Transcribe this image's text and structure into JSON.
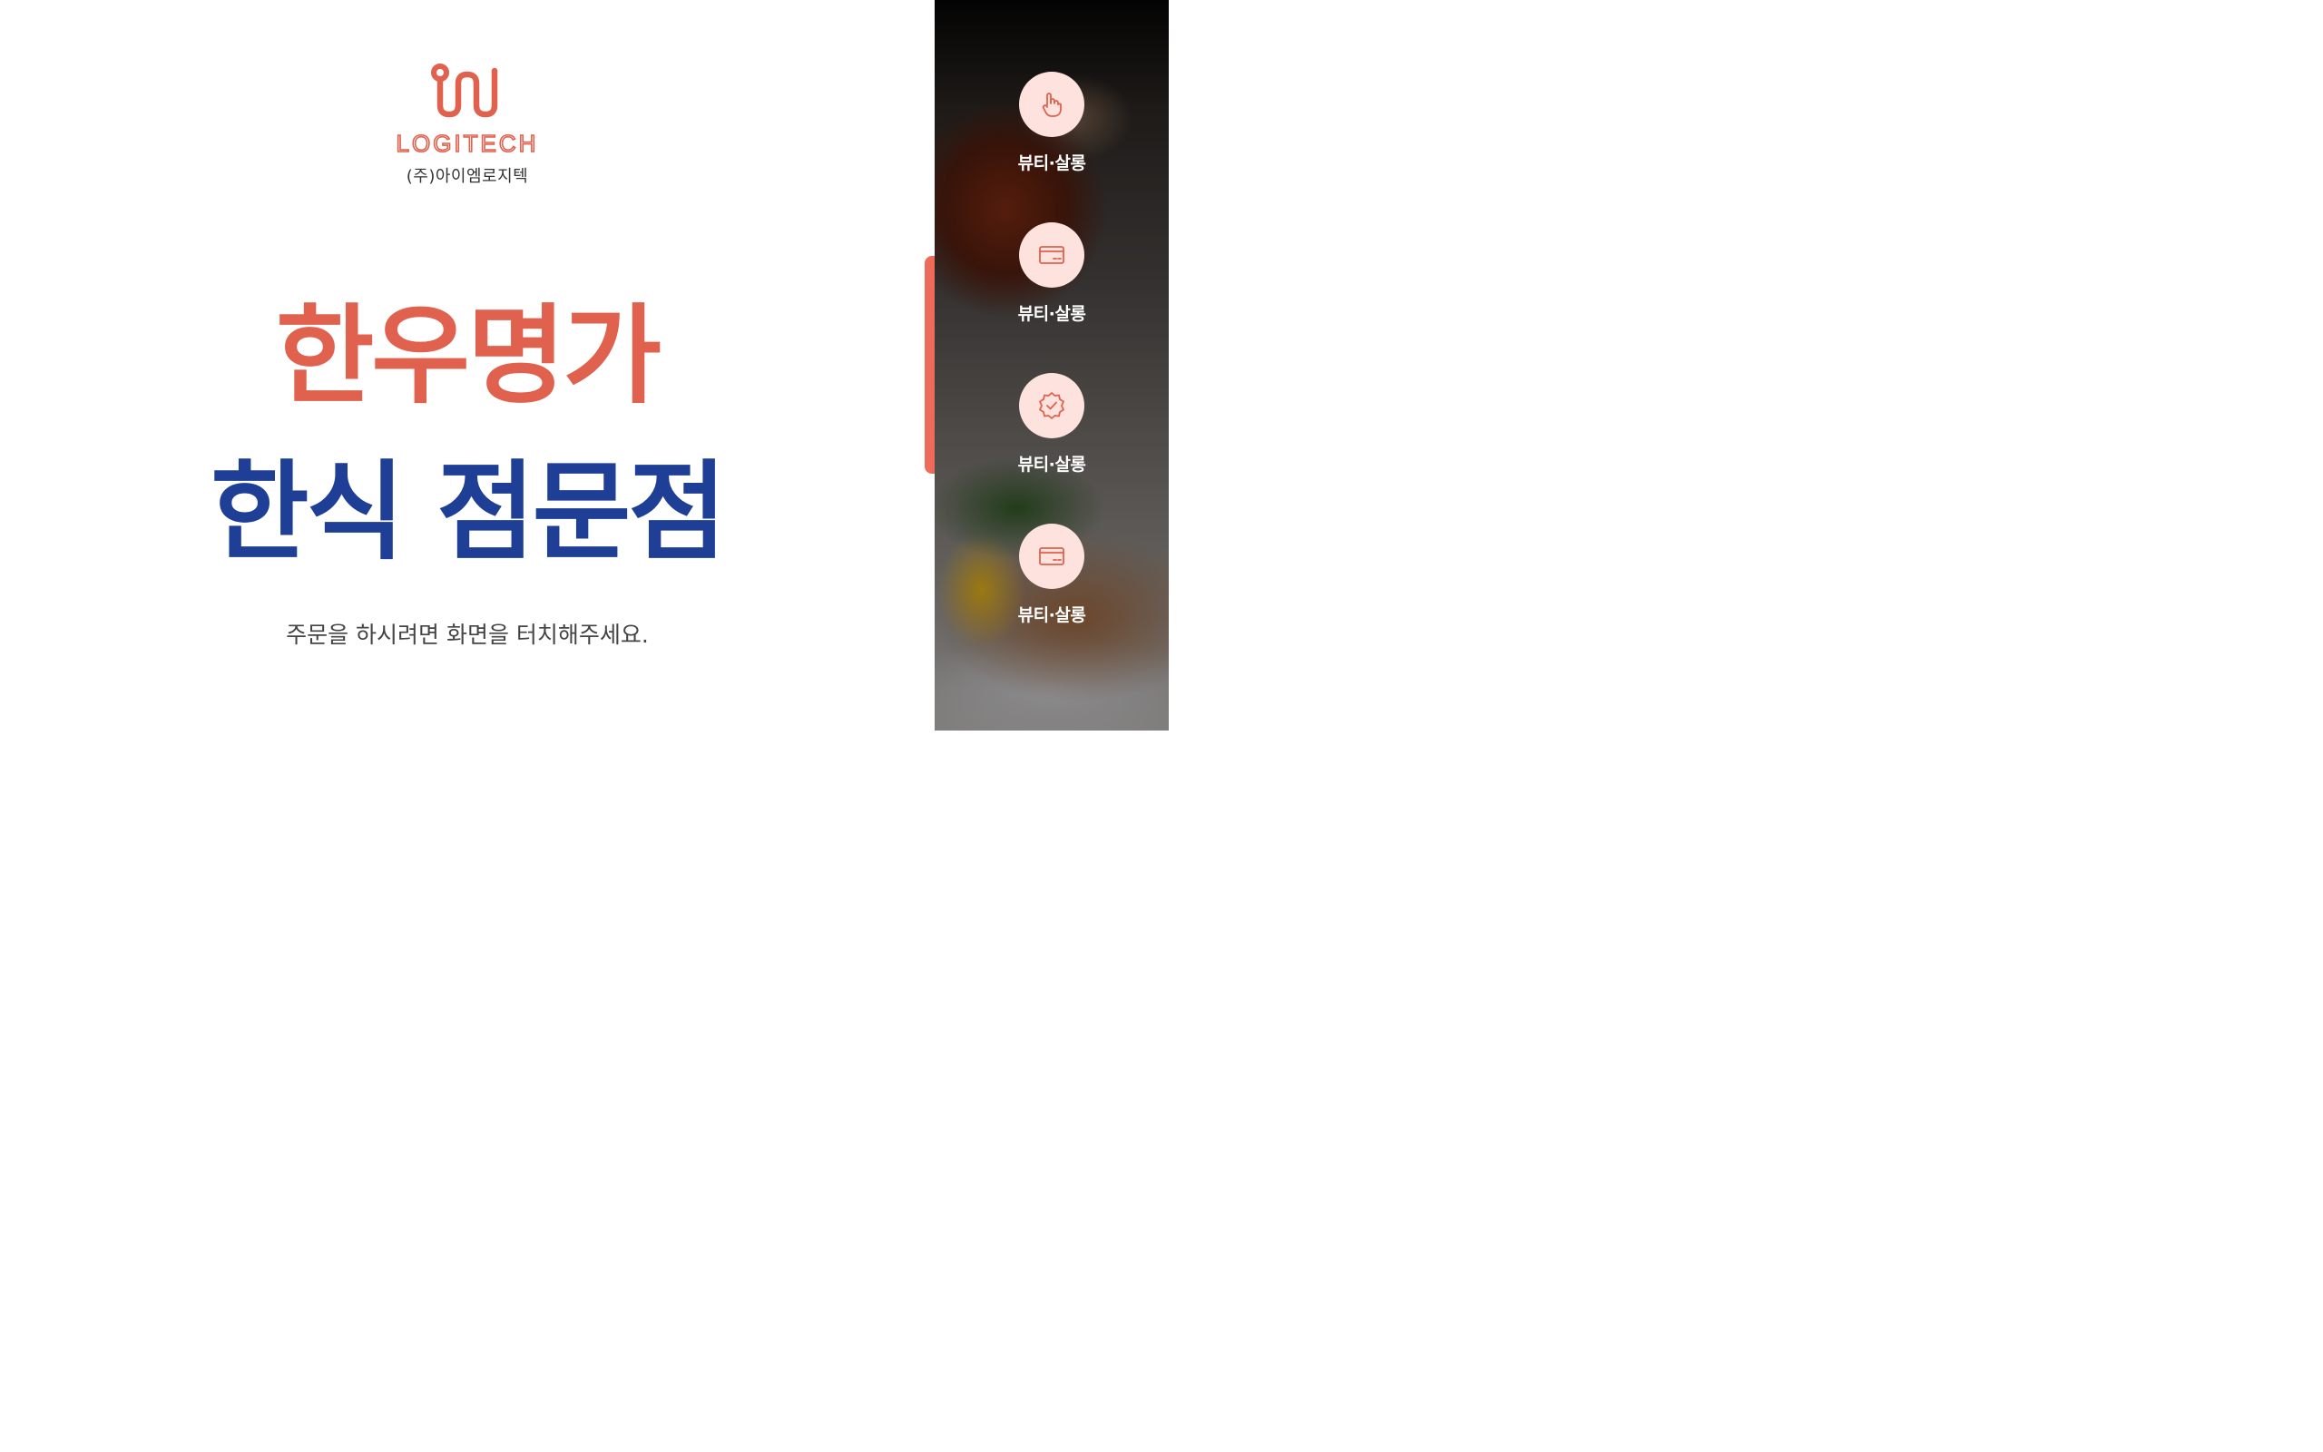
{
  "brand": {
    "wordmark": "LOGITECH",
    "company": "(주)아이엠로지텍",
    "color": "#e0614e"
  },
  "intro": {
    "title": "한우명가",
    "subtitle": "한식 점문점",
    "prompt": "주문을 하시려면 화면을 터치해주세요.",
    "title_color": "#e0614e",
    "subtitle_color": "#1f3f96"
  },
  "menu": {
    "accent_color": "#ee6a5a",
    "items": [
      {
        "label": "뷰티·살롱",
        "icon": "pointer-hand-icon"
      },
      {
        "label": "뷰티·살롱",
        "icon": "card-icon"
      },
      {
        "label": "뷰티·살롱",
        "icon": "verified-badge-icon"
      },
      {
        "label": "뷰티·살롱",
        "icon": "card-icon"
      }
    ]
  }
}
